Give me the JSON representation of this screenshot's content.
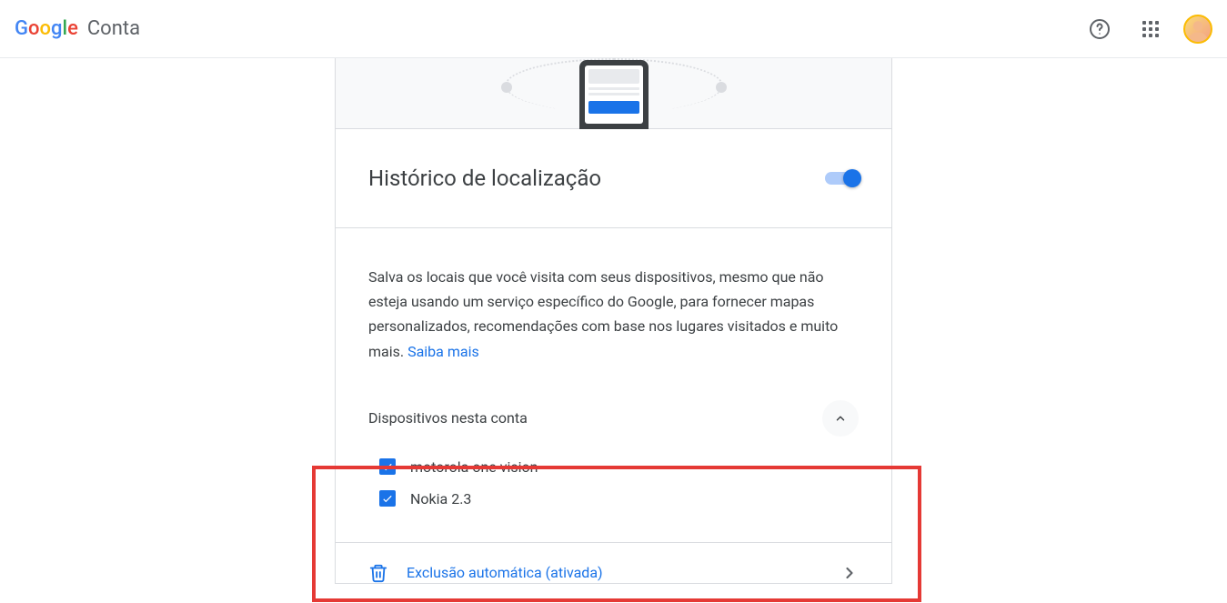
{
  "header": {
    "logo_letters": [
      "G",
      "o",
      "o",
      "g",
      "l",
      "e"
    ],
    "account_label": "Conta"
  },
  "card": {
    "title": "Histórico de localização",
    "toggle_on": true,
    "description": "Salva os locais que você visita com seus dispositivos, mesmo que não esteja usando um serviço específico do Google, para fornecer mapas personalizados, recomendações com base nos lugares visitados e muito mais. ",
    "learn_more": "Saiba mais",
    "devices_title": "Dispositivos nesta conta",
    "devices": [
      {
        "label": "motorola one vision",
        "checked": true
      },
      {
        "label": "Nokia 2.3",
        "checked": true
      }
    ],
    "auto_delete": "Exclusão automática (ativada)"
  }
}
